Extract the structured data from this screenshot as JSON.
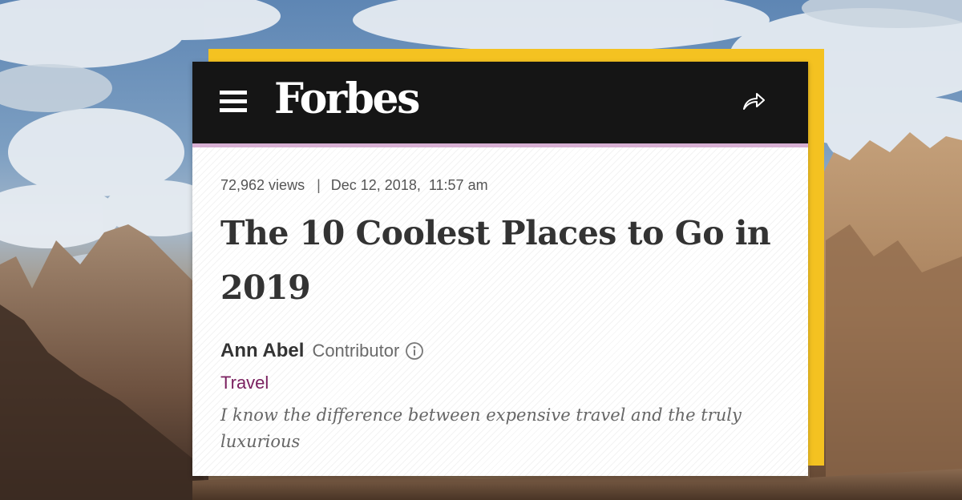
{
  "header": {
    "logo_text": "Forbes",
    "menu_icon": "hamburger-menu-icon",
    "share_icon": "share-arrow-icon"
  },
  "article": {
    "views": "72,962 views",
    "separator": "|",
    "date": "Dec 12, 2018,",
    "time": "11:57 am",
    "title": "The 10 Coolest Places to Go in 2019",
    "author": "Ann Abel",
    "author_role": "Contributor",
    "info_icon": "info-circle-icon",
    "channel": "Travel",
    "tagline": "I know the difference between expensive travel and the truly luxurious"
  },
  "colors": {
    "frame_accent": "#f4c221",
    "header_bg": "#151515",
    "header_underline": "#d7afd2",
    "channel_link": "#7b2160"
  }
}
